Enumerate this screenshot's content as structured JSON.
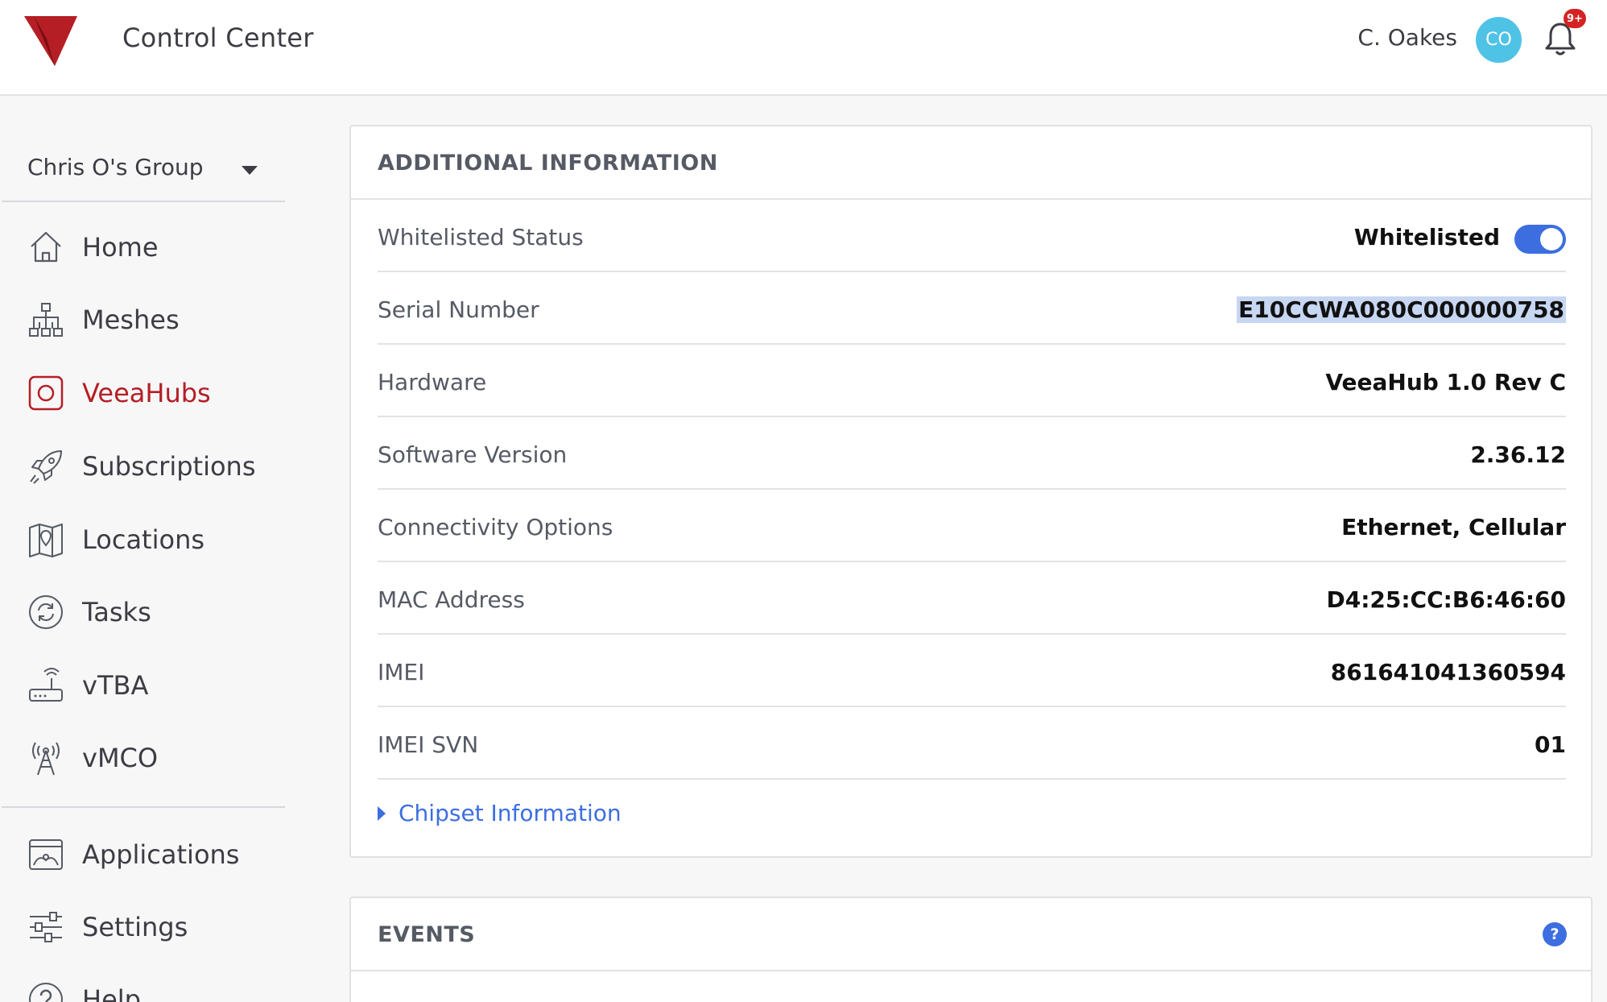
{
  "header": {
    "app_title": "Control Center",
    "user_name": "C. Oakes",
    "avatar_initials": "CO",
    "notification_badge": "9+",
    "brand_color": "#b51e24",
    "avatar_color": "#4fc3e6"
  },
  "sidebar": {
    "group_name": "Chris O's Group",
    "items": [
      {
        "label": "Home",
        "icon": "home-icon"
      },
      {
        "label": "Meshes",
        "icon": "mesh-network-icon"
      },
      {
        "label": "VeeaHubs",
        "icon": "veeahub-icon",
        "active": true
      },
      {
        "label": "Subscriptions",
        "icon": "rocket-icon"
      },
      {
        "label": "Locations",
        "icon": "map-pin-icon"
      },
      {
        "label": "Tasks",
        "icon": "refresh-icon"
      },
      {
        "label": "vTBA",
        "icon": "router-icon"
      },
      {
        "label": "vMCO",
        "icon": "antenna-tower-icon"
      },
      {
        "label": "Applications",
        "icon": "applications-icon"
      },
      {
        "label": "Settings",
        "icon": "sliders-icon"
      },
      {
        "label": "Help",
        "icon": "help-icon"
      }
    ],
    "accent_color": "#b51e24"
  },
  "additional_info": {
    "title": "ADDITIONAL INFORMATION",
    "whitelisted": {
      "label": "Whitelisted Status",
      "value": "Whitelisted",
      "enabled": true
    },
    "rows": [
      {
        "label": "Serial Number",
        "value": "E10CCWA080C000000758",
        "selected": true
      },
      {
        "label": "Hardware",
        "value": "VeeaHub 1.0 Rev C"
      },
      {
        "label": "Software Version",
        "value": "2.36.12"
      },
      {
        "label": "Connectivity Options",
        "value": "Ethernet, Cellular"
      },
      {
        "label": "MAC Address",
        "value": "D4:25:CC:B6:46:60"
      },
      {
        "label": "IMEI",
        "value": "861641041360594"
      },
      {
        "label": "IMEI SVN",
        "value": "01"
      }
    ],
    "chipset_link": "Chipset Information",
    "link_color": "#3c6ee0"
  },
  "events": {
    "title": "EVENTS",
    "help_glyph": "?"
  }
}
